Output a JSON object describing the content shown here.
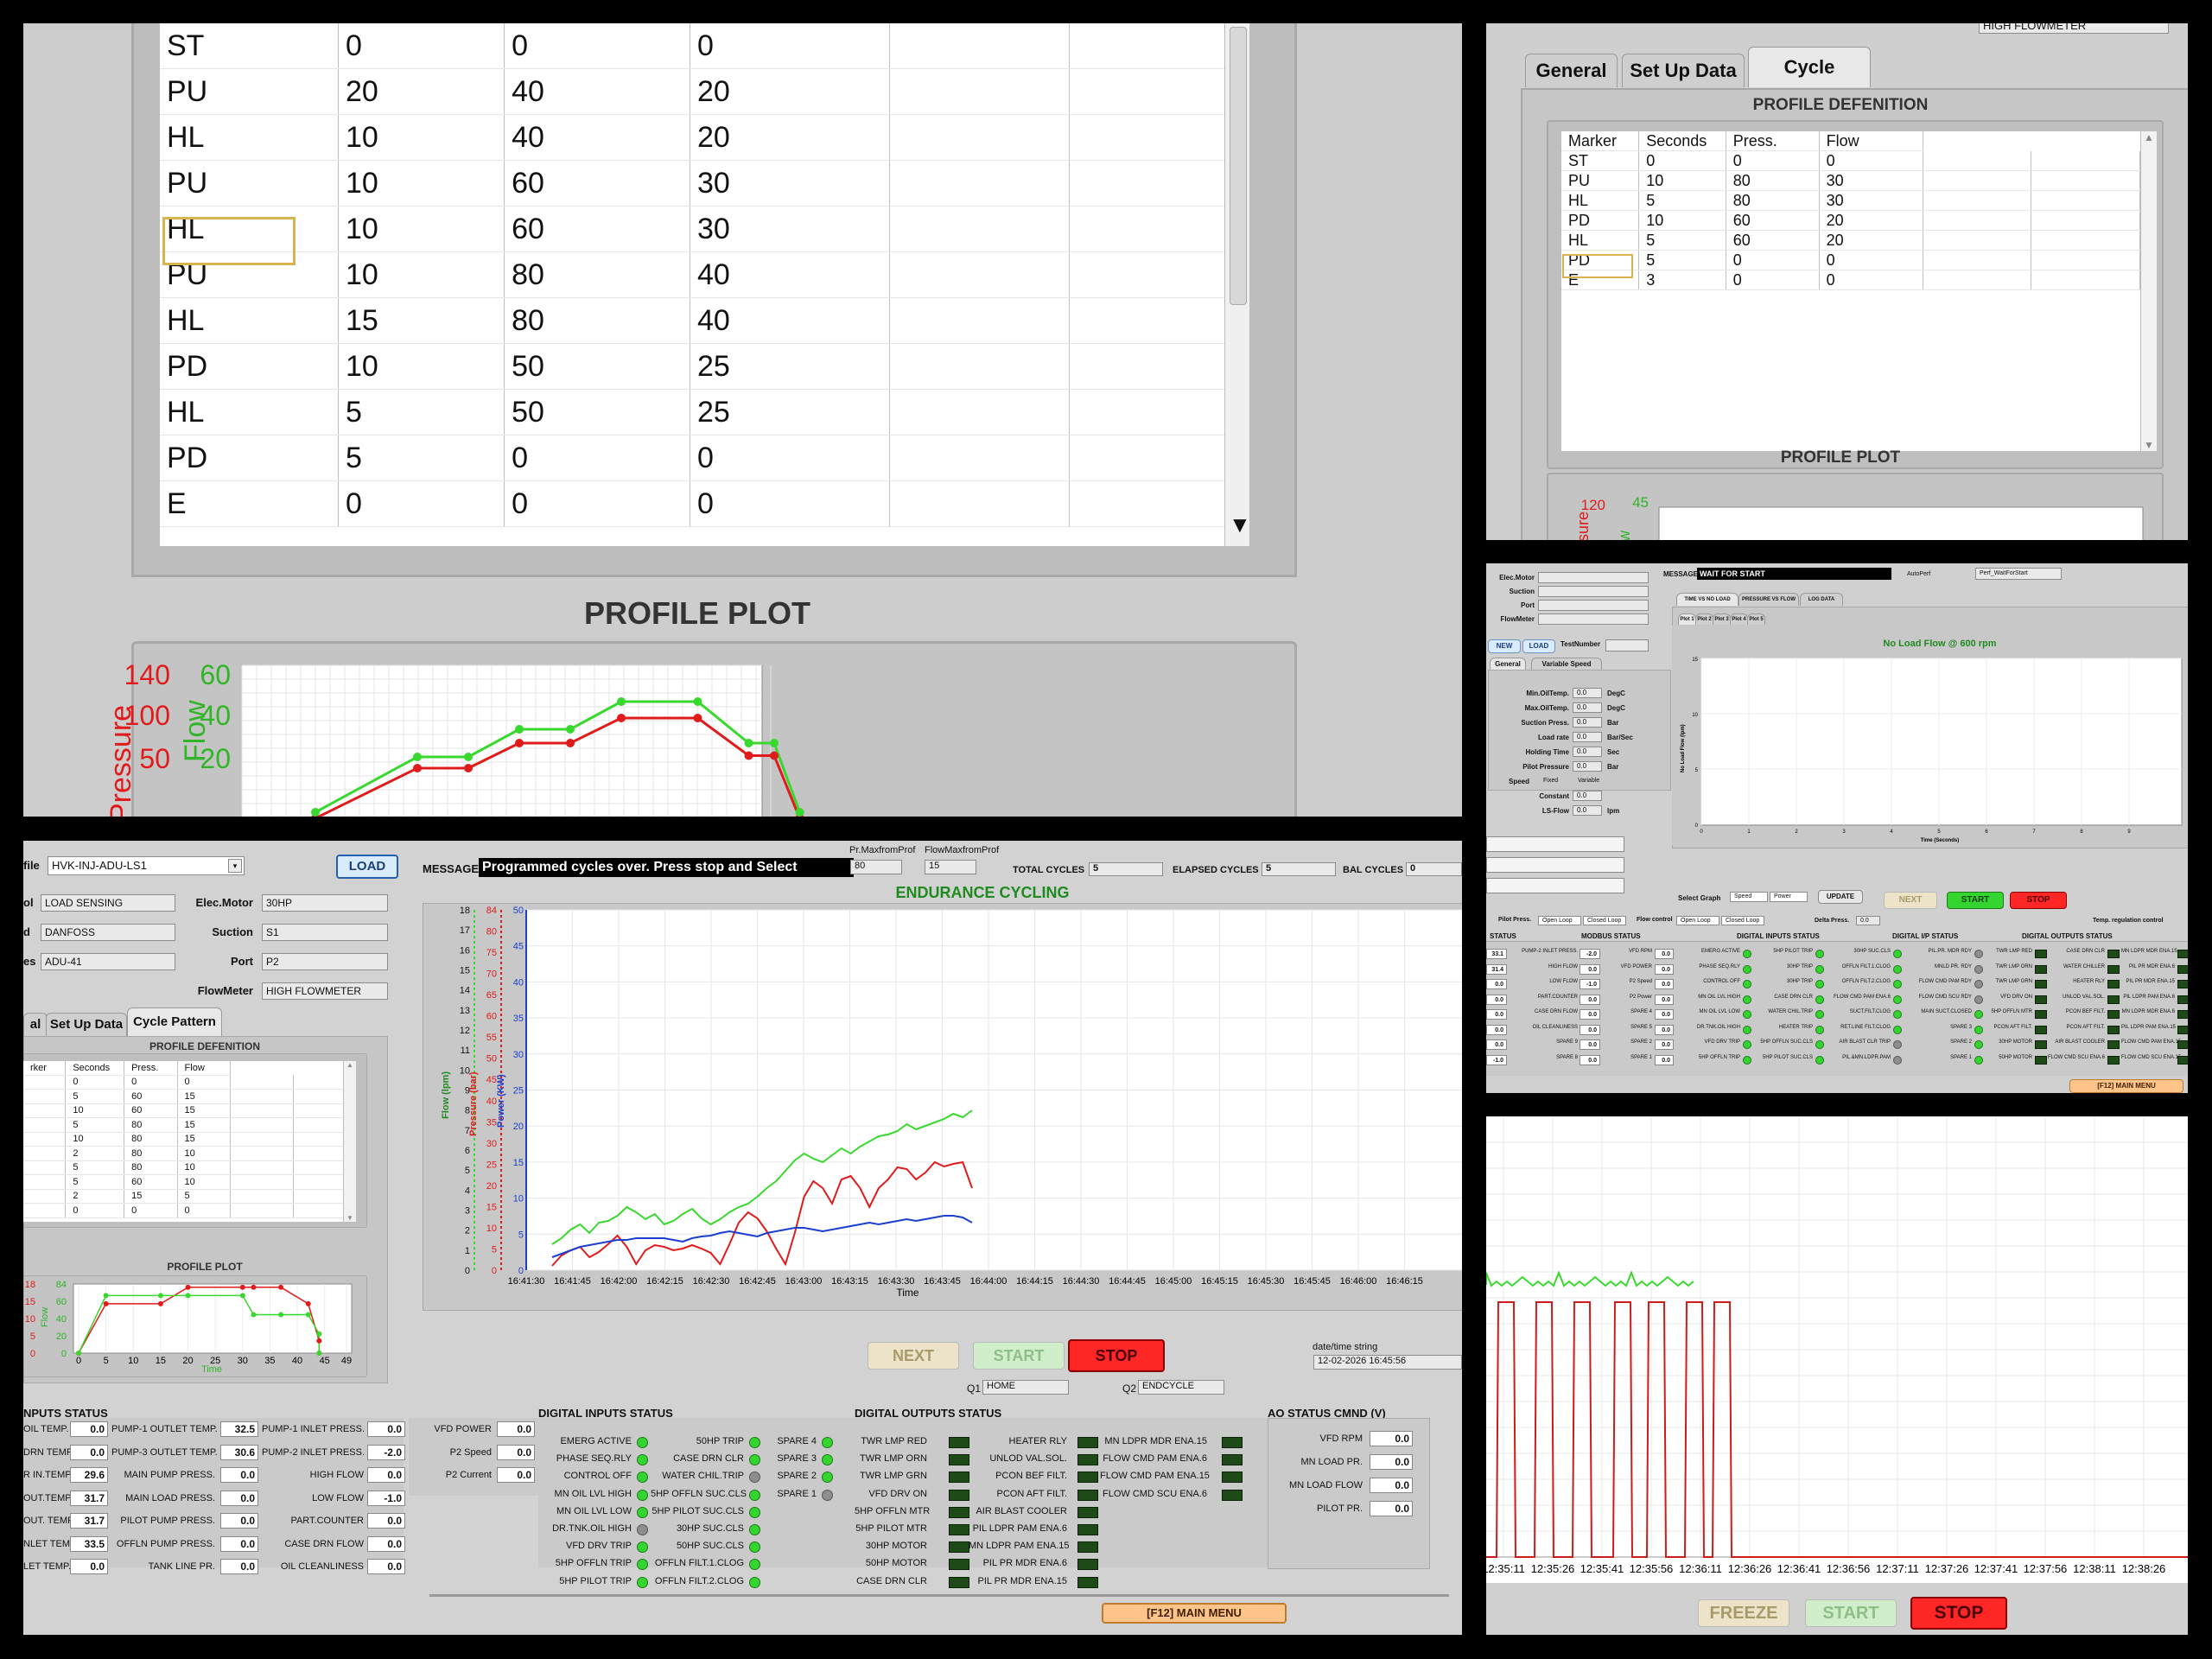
{
  "top_left": {
    "rows": [
      [
        "ST",
        "0",
        "0",
        "0"
      ],
      [
        "PU",
        "20",
        "40",
        "20"
      ],
      [
        "HL",
        "10",
        "40",
        "20"
      ],
      [
        "PU",
        "10",
        "60",
        "30"
      ],
      [
        "HL",
        "10",
        "60",
        "30"
      ],
      [
        "PU",
        "10",
        "80",
        "40"
      ],
      [
        "HL",
        "15",
        "80",
        "40"
      ],
      [
        "PD",
        "10",
        "50",
        "25"
      ],
      [
        "HL",
        "5",
        "50",
        "25"
      ],
      [
        "PD",
        "5",
        "0",
        "0"
      ],
      [
        "E",
        "0",
        "0",
        "0"
      ]
    ],
    "section_title": "PROFILE PLOT",
    "axis_left_ticks": [
      "140",
      "100",
      "50"
    ],
    "axis_right_ticks": [
      "60",
      "40",
      "20"
    ],
    "axis_left_label": "Pressure",
    "axis_right_label": "Flow",
    "colors": {
      "pressure": "#e01b1b",
      "flow": "#39d82e"
    }
  },
  "top_right": {
    "field_top": "HIGH FLOWMETER",
    "tabs": [
      "General",
      "Set Up Data",
      "Cycle Pattern"
    ],
    "section_title": "PROFILE DEFENITION",
    "headers": [
      "Marker",
      "Seconds",
      "Press.",
      "Flow"
    ],
    "rows": [
      [
        "ST",
        "0",
        "0",
        "0"
      ],
      [
        "PU",
        "10",
        "80",
        "30"
      ],
      [
        "HL",
        "5",
        "80",
        "30"
      ],
      [
        "PD",
        "10",
        "60",
        "20"
      ],
      [
        "HL",
        "5",
        "60",
        "20"
      ],
      [
        "PD",
        "5",
        "0",
        "0"
      ],
      [
        "E",
        "3",
        "0",
        "0"
      ]
    ],
    "plot_title": "PROFILE PLOT",
    "tick_p": "120",
    "tick_f": "45",
    "label_p": "sure",
    "label_f": "w"
  },
  "mid_right": {
    "fields": [
      "Elec.Motor",
      "Suction",
      "Port",
      "FlowMeter"
    ],
    "buttons": {
      "new": "NEW",
      "load": "LOAD",
      "test_number": "TestNumber"
    },
    "tabs": [
      "General",
      "Variable Speed"
    ],
    "params": [
      {
        "label": "Min.OilTemp.",
        "value": "0.0",
        "unit": "DegC"
      },
      {
        "label": "Max.OilTemp.",
        "value": "0.0",
        "unit": "DegC"
      },
      {
        "label": "Suction Press.",
        "value": "0.0",
        "unit": "Bar"
      },
      {
        "label": "Load rate",
        "value": "0.0",
        "unit": "Bar/Sec"
      },
      {
        "label": "Holding Time",
        "value": "0.0",
        "unit": "Sec"
      },
      {
        "label": "Pilot Pressure",
        "value": "0.0",
        "unit": "Bar"
      }
    ],
    "speed_label": "Speed",
    "speed_opts": [
      "Fixed",
      "Variable"
    ],
    "constant_label": "Constant",
    "constant_value": "0.0",
    "lsflow_label": "LS-Flow",
    "lsflow_value": "0.0",
    "lsflow_unit": "lpm",
    "message_label": "MESSAGE",
    "message": "WAIT FOR START",
    "autoperf_label": "AutoPerf",
    "autoperf_value": "Perf_WaitForStart",
    "graph_tabs": [
      "TIME VS NO LOAD FLOW",
      "PRESSURE VS FLOW",
      "LOG DATA"
    ],
    "plot_tabs": [
      "Plot 1",
      "Plot 2",
      "Plot 3",
      "Plot 4",
      "Plot 5"
    ],
    "chart_title": "No Load Flow @ 600 rpm",
    "y_label": "No Load Flow (lpm)",
    "x_label": "Time (Seconds)",
    "y_ticks": [
      "15",
      "10",
      "5",
      "0"
    ],
    "x_ticks": [
      "0",
      "1",
      "2",
      "3",
      "4",
      "5",
      "6",
      "7",
      "8",
      "9"
    ],
    "select_graph": "Select Graph",
    "graph_opts": [
      "Speed",
      "Power"
    ],
    "update": "UPDATE",
    "next": "NEXT",
    "start": "START",
    "stop": "STOP",
    "temp_reg": "Temp. regulation control",
    "pilot_press": "Pilot Press.",
    "loop_opts": [
      "Open Loop",
      "Closed Loop"
    ],
    "flow_control": "Flow control",
    "delta_press": "Delta Press.",
    "delta_value": "0.0",
    "status_headers": [
      "STATUS",
      "MODBUS STATUS",
      "DIGITAL INPUTS STATUS",
      "DIGITAL I/P STATUS",
      "DIGITAL OUTPUTS STATUS"
    ],
    "col1": [
      [
        "33.1",
        "PUMP-2 INLET PRESS.",
        "-2.0"
      ],
      [
        "31.4",
        "HIGH FLOW",
        "0.0"
      ],
      [
        "0.0",
        "LOW FLOW",
        "-1.0"
      ],
      [
        "0.0",
        "PART.COUNTER",
        "0.0"
      ],
      [
        "0.0",
        "CASE DRN FLOW",
        "0.0"
      ],
      [
        "0.0",
        "OIL CLEANLINESS",
        "0.0"
      ],
      [
        "0.0",
        "SPARE 9",
        "0.0"
      ],
      [
        "-1.0",
        "SPARE 8",
        "0.0"
      ]
    ],
    "col2": [
      [
        "VFD RPM",
        "0.0"
      ],
      [
        "VFD POWER",
        "0.0"
      ],
      [
        "P2 Speed",
        "0.0"
      ],
      [
        "P2 Power",
        "0.0"
      ],
      [
        "SPARE 4",
        "0.0"
      ],
      [
        "SPARE 5",
        "0.0"
      ],
      [
        "SPARE 2",
        "0.0"
      ],
      [
        "SPARE 1",
        "0.0"
      ]
    ],
    "col3": [
      "EMERG ACTIVE",
      "PHASE SEQ.RLY",
      "CONTROL OFF",
      "MN OIL LVL HIGH",
      "MN OIL LVL LOW",
      "DR.TNK.OIL HIGH",
      "VFD DRV TRIP",
      "5HP OFFLN TRIP"
    ],
    "col4": [
      "5HP PILOT TRIP",
      "30HP TRIP",
      "30HP TRIP",
      "CASE DRN CLR",
      "WATER CHIL.TRIP",
      "HEATER TRIP",
      "5HP OFFLN SUC.CLS",
      "5HP PILOT SUC.CLS"
    ],
    "col5": [
      "30HP SUC.CLS",
      "OFFLN FILT.1.CLOG",
      "OFFLN FILT.2.CLOG",
      "FLOW CMD PAM ENA.6",
      "SUCT.FILT.CLOG",
      "RET.LINE FILT.CLOG",
      "AIR BLAST CLR TRIP",
      "PIL.&MN.LDPR.PAM"
    ],
    "col6": [
      "PIL.PR. MDR RDY",
      "MNLD PR. RDY",
      "FLOW CMD PAM RDY",
      "FLOW CMD SCU RDY",
      "MAIN SUCT.CLOSED",
      "SPARE 3",
      "SPARE 2",
      "SPARE 1"
    ],
    "col7": [
      "TWR LMP RED",
      "TWR LMP ORN",
      "TWR LMP GRN",
      "VFD DRV ON",
      "5HP OFFLN MTR",
      "PCON AFT FILT.",
      "30HP MOTOR",
      "50HP MOTOR"
    ],
    "col8": [
      "CASE DRN CLR",
      "WATER CHILLER",
      "HEATER RLY",
      "UNLOD VAL.SOL.",
      "PCON BEF FILT.",
      "PCON AFT FILT.",
      "AIR BLAST COOLER",
      "FLOW CMD SCU ENA.6"
    ],
    "col9": [
      "MN LDPR MDR ENA.15",
      "PIL PR MDR ENA.6",
      "PIL PR MDR ENA.15",
      "PIL LDPR PAM ENA.6",
      "MN LDPR MDR ENA.6",
      "PIL LDPR PAM ENA.15",
      "FLOW CMD PAM ENA.15",
      "FLOW CMD SCU ENA.15"
    ],
    "main_menu": "[F12] MAIN MENU"
  },
  "bottom_right": {
    "x_ticks": [
      "12:35:11",
      "12:35:26",
      "12:35:41",
      "12:35:56",
      "12:36:11",
      "12:36:26",
      "12:36:41",
      "12:36:56",
      "12:37:11",
      "12:37:26",
      "12:37:41",
      "12:37:56",
      "12:38:11",
      "12:38:26"
    ],
    "freeze": "FREEZE",
    "start": "START",
    "stop": "STOP"
  },
  "main": {
    "profile_label": "file",
    "profile_value": "HVK-INJ-ADU-LS1",
    "load": "LOAD",
    "left_fields": [
      [
        "ol",
        "LOAD SENSING"
      ],
      [
        "d",
        "DANFOSS"
      ],
      [
        "es",
        "ADU-41"
      ]
    ],
    "right_fields": [
      [
        "Elec.Motor",
        "30HP"
      ],
      [
        "Suction",
        "S1"
      ],
      [
        "Port",
        "P2"
      ],
      [
        "FlowMeter",
        "HIGH FLOWMETER"
      ]
    ],
    "tabs": [
      "al",
      "Set Up Data",
      "Cycle Pattern"
    ],
    "profile_def_title": "PROFILE DEFENITION",
    "headers": [
      "rker",
      "Seconds",
      "Press.",
      "Flow"
    ],
    "rows": [
      [
        "",
        "0",
        "0",
        "0"
      ],
      [
        "",
        "5",
        "60",
        "15"
      ],
      [
        "",
        "10",
        "60",
        "15"
      ],
      [
        "",
        "5",
        "80",
        "15"
      ],
      [
        "",
        "10",
        "80",
        "15"
      ],
      [
        "",
        "2",
        "80",
        "10"
      ],
      [
        "",
        "5",
        "80",
        "10"
      ],
      [
        "",
        "5",
        "60",
        "10"
      ],
      [
        "",
        "2",
        "15",
        "5"
      ],
      [
        "",
        "0",
        "0",
        "0"
      ]
    ],
    "profile_plot_title": "PROFILE PLOT",
    "pp_left_ticks": [
      "18",
      "15",
      "10",
      "5",
      "0"
    ],
    "pp_right_ticks": [
      "84",
      "60",
      "40",
      "20",
      "0"
    ],
    "pp_x_ticks": [
      "0",
      "5",
      "10",
      "15",
      "20",
      "25",
      "30",
      "35",
      "40",
      "45",
      "49"
    ],
    "pp_flow_label": "Flow",
    "pp_x_label": "Time",
    "message_label": "MESSAGE",
    "message": "Programmed cycles over. Press stop and Select",
    "prmax_label": "Pr.MaxfromProf",
    "prmax_value": "80",
    "flowmax_label": "FlowMaxfromProf",
    "flowmax_value": "15",
    "total_cycles_label": "TOTAL CYCLES",
    "total_cycles": "5",
    "elapsed_label": "ELAPSED CYCLES",
    "elapsed": "5",
    "bal_label": "BAL CYCLES",
    "bal": "0",
    "chart_title": "ENDURANCE CYCLING",
    "axis_flow_label": "Flow (lpm)",
    "axis_pressure_label": "Pressure (bar)",
    "axis_power_label": "Power (KW)",
    "axis_flow_ticks": [
      "18",
      "17",
      "16",
      "15",
      "14",
      "13",
      "12",
      "11",
      "10",
      "9",
      "8",
      "7",
      "6",
      "5",
      "4",
      "3",
      "2",
      "1",
      "0"
    ],
    "axis_pressure_ticks": [
      "84",
      "80",
      "75",
      "70",
      "65",
      "60",
      "55",
      "50",
      "45",
      "40",
      "35",
      "30",
      "25",
      "20",
      "15",
      "10",
      "5",
      "0"
    ],
    "axis_power_ticks": [
      "50",
      "45",
      "40",
      "35",
      "30",
      "25",
      "20",
      "15",
      "10",
      "5",
      "0"
    ],
    "x_ticks": [
      "16:41:30",
      "16:41:45",
      "16:42:00",
      "16:42:15",
      "16:42:30",
      "16:42:45",
      "16:43:00",
      "16:43:15",
      "16:43:30",
      "16:43:45",
      "16:44:00",
      "16:44:15",
      "16:44:30",
      "16:44:45",
      "16:45:00",
      "16:45:15",
      "16:45:30",
      "16:45:45",
      "16:46:00",
      "16:46:15"
    ],
    "x_label": "Time",
    "next": "NEXT",
    "start": "START",
    "stop": "STOP",
    "datetime_label": "date/time string",
    "datetime_value": "12-02-2026 16:45:56",
    "q1_label": "Q1",
    "q1_value": "HOME",
    "q2_label": "Q2",
    "q2_value": "ENDCYCLE",
    "inputs_status_title": "NPUTS STATUS",
    "analog_col1": [
      [
        "OIL TEMP.",
        "0.0"
      ],
      [
        "DRN TEMP.",
        "0.0"
      ],
      [
        "R IN.TEMP.",
        "29.6"
      ],
      [
        "OUT.TEMP.",
        "31.7"
      ],
      [
        "OUT. TEMP.",
        "31.7"
      ],
      [
        "NLET TEMP.",
        "33.5"
      ],
      [
        "LET TEMP.",
        "0.0"
      ]
    ],
    "analog_col2": [
      [
        "PUMP-1 OUTLET TEMP.",
        "32.5"
      ],
      [
        "PUMP-3 OUTLET TEMP.",
        "30.6"
      ],
      [
        "MAIN PUMP PRESS.",
        "0.0"
      ],
      [
        "MAIN LOAD PRESS.",
        "0.0"
      ],
      [
        "PILOT PUMP PRESS.",
        "0.0"
      ],
      [
        "OFFLN PUMP PRESS.",
        "0.0"
      ],
      [
        "TANK LINE PR.",
        "0.0"
      ]
    ],
    "analog_col3": [
      [
        "PUMP-1 INLET PRESS.",
        "0.0"
      ],
      [
        "PUMP-2 INLET PRESS.",
        "-2.0"
      ],
      [
        "HIGH FLOW",
        "0.0"
      ],
      [
        "LOW FLOW",
        "-1.0"
      ],
      [
        "PART.COUNTER",
        "0.0"
      ],
      [
        "CASE DRN FLOW",
        "0.0"
      ],
      [
        "OIL CLEANLINESS",
        "0.0"
      ]
    ],
    "analog_col4": [
      [
        "VFD POWER",
        "0.0"
      ],
      [
        "P2 Speed",
        "0.0"
      ],
      [
        "P2 Current",
        "0.0"
      ]
    ],
    "di_title": "DIGITAL INPUTS STATUS",
    "di_col1": [
      [
        "EMERG ACTIVE",
        1
      ],
      [
        "PHASE SEQ.RLY",
        1
      ],
      [
        "CONTROL OFF",
        1
      ],
      [
        "MN OIL LVL HIGH",
        1
      ],
      [
        "MN OIL LVL LOW",
        1
      ],
      [
        "DR.TNK.OIL HIGH",
        0
      ],
      [
        "VFD DRV TRIP",
        1
      ],
      [
        "5HP OFFLN TRIP",
        1
      ],
      [
        "5HP PILOT TRIP",
        1
      ]
    ],
    "di_col2": [
      [
        "50HP TRIP",
        1
      ],
      [
        "CASE DRN CLR",
        1
      ],
      [
        "WATER CHIL.TRIP",
        0
      ],
      [
        "5HP OFFLN SUC.CLS",
        1
      ],
      [
        "5HP PILOT SUC.CLS",
        1
      ],
      [
        "30HP SUC.CLS",
        1
      ],
      [
        "50HP SUC.CLS",
        1
      ],
      [
        "OFFLN FILT.1.CLOG",
        1
      ],
      [
        "OFFLN FILT.2.CLOG",
        1
      ]
    ],
    "di_col3": [
      [
        "SPARE 4",
        1
      ],
      [
        "SPARE 3",
        1
      ],
      [
        "SPARE 2",
        1
      ],
      [
        "SPARE 1",
        0
      ]
    ],
    "do_title": "DIGITAL OUTPUTS STATUS",
    "do_col1": [
      "TWR LMP RED",
      "TWR LMP ORN",
      "TWR LMP GRN",
      "VFD DRV ON",
      "5HP OFFLN MTR",
      "5HP PILOT MTR",
      "30HP MOTOR",
      "50HP MOTOR",
      "CASE DRN CLR"
    ],
    "do_col2": [
      "HEATER RLY",
      "UNLOD VAL.SOL.",
      "PCON BEF FILT.",
      "PCON AFT FILT.",
      "AIR BLAST COOLER",
      "PIL LDPR PAM ENA.6",
      "MN LDPR PAM ENA.15",
      "PIL PR MDR ENA.6",
      "PIL PR MDR ENA.15"
    ],
    "do_col3": [
      "MN LDPR MDR ENA.15",
      "FLOW CMD PAM ENA.6",
      "FLOW CMD PAM ENA.15",
      "FLOW CMD SCU ENA.6"
    ],
    "ao_title": "AO STATUS CMND (V)",
    "ao": [
      [
        "VFD RPM",
        "0.0"
      ],
      [
        "MN LOAD PR.",
        "0.0"
      ],
      [
        "MN LOAD FLOW",
        "0.0"
      ],
      [
        "PILOT PR.",
        "0.0"
      ]
    ],
    "main_menu": "[F12] MAIN MENU"
  }
}
